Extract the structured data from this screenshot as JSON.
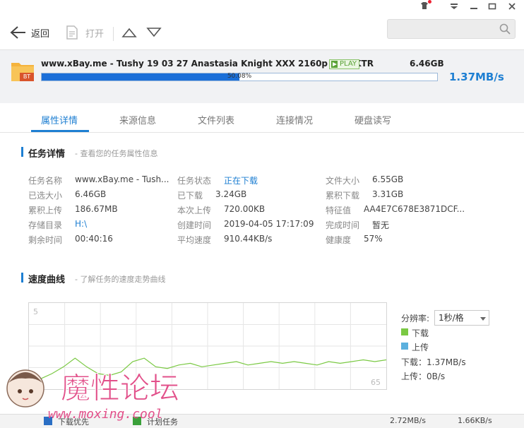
{
  "toolbar": {
    "back_label": "返回",
    "open_label": "打开",
    "search_placeholder": ""
  },
  "task": {
    "name": "www.xBay.me - Tushy 19 03 27 Anastasia Knight XXX 2160p MP4-KTR",
    "play_badge": "PLAY",
    "file_badge": "BT",
    "size": "6.46GB",
    "progress_percent": 50.08,
    "progress_text": "50.08%",
    "speed": "1.37MB/s"
  },
  "tabs": [
    {
      "label": "属性详情",
      "active": true
    },
    {
      "label": "来源信息"
    },
    {
      "label": "文件列表"
    },
    {
      "label": "连接情况"
    },
    {
      "label": "硬盘读写"
    }
  ],
  "details": {
    "title": "任务详情",
    "subtitle": "- 查看您的任务属性信息",
    "col1": [
      {
        "label": "任务名称",
        "value": "www.xBay.me - Tush..."
      },
      {
        "label": "已选大小",
        "value": "6.46GB"
      },
      {
        "label": "累积上传",
        "value": "186.67MB"
      },
      {
        "label": "存储目录",
        "value": "H:\\"
      },
      {
        "label": "剩余时间",
        "value": "00:40:16"
      }
    ],
    "col2": [
      {
        "label": "任务状态",
        "value": "正在下载"
      },
      {
        "label": "已下载",
        "value": "3.24GB"
      },
      {
        "label": "本次上传",
        "value": "720.00KB"
      },
      {
        "label": "创建时间",
        "value": "2019-04-05 17:17:09"
      },
      {
        "label": "平均速度",
        "value": "910.44KB/s"
      }
    ],
    "col3": [
      {
        "label": "文件大小",
        "value": "6.55GB"
      },
      {
        "label": "累积下载",
        "value": "3.31GB"
      },
      {
        "label": "特征值",
        "value": "AA4E7C678E3871DCF..."
      },
      {
        "label": "完成时间",
        "value": "暂无"
      },
      {
        "label": "健康度",
        "value": "57%"
      }
    ]
  },
  "speed_section": {
    "title": "速度曲线",
    "subtitle": "- 了解任务的速度走势曲线",
    "resolution_label": "分辨率:",
    "resolution_value": "1秒/格",
    "legend_download": "下载",
    "legend_upload": "上传",
    "download_readout": "下载：1.37MB/s",
    "upload_readout": "上传：0B/s",
    "colors": {
      "download": "#7ac943",
      "upload": "#5bb0de"
    }
  },
  "chart_data": {
    "type": "line",
    "y_top_label": "5",
    "x_right_label": "65",
    "grid": true,
    "series": [
      {
        "name": "下载",
        "color": "#7ac943",
        "values": [
          0.3,
          0.6,
          0.9,
          1.3,
          1.8,
          1.3,
          0.9,
          0.8,
          1.0,
          1.6,
          1.8,
          1.3,
          1.2,
          1.4,
          1.5,
          1.3,
          1.4,
          1.5,
          1.6,
          1.4,
          1.5,
          1.6,
          1.5,
          1.6,
          1.5,
          1.4,
          1.6,
          1.5,
          1.6,
          1.7,
          1.6,
          1.7
        ]
      }
    ]
  },
  "watermark": {
    "text": "魔性论坛",
    "url": "www.moxing.cool"
  },
  "status": {
    "left1": "下载优先",
    "left2": "计划任务",
    "right1": "2.72MB/s",
    "right2": "1.66KB/s"
  }
}
